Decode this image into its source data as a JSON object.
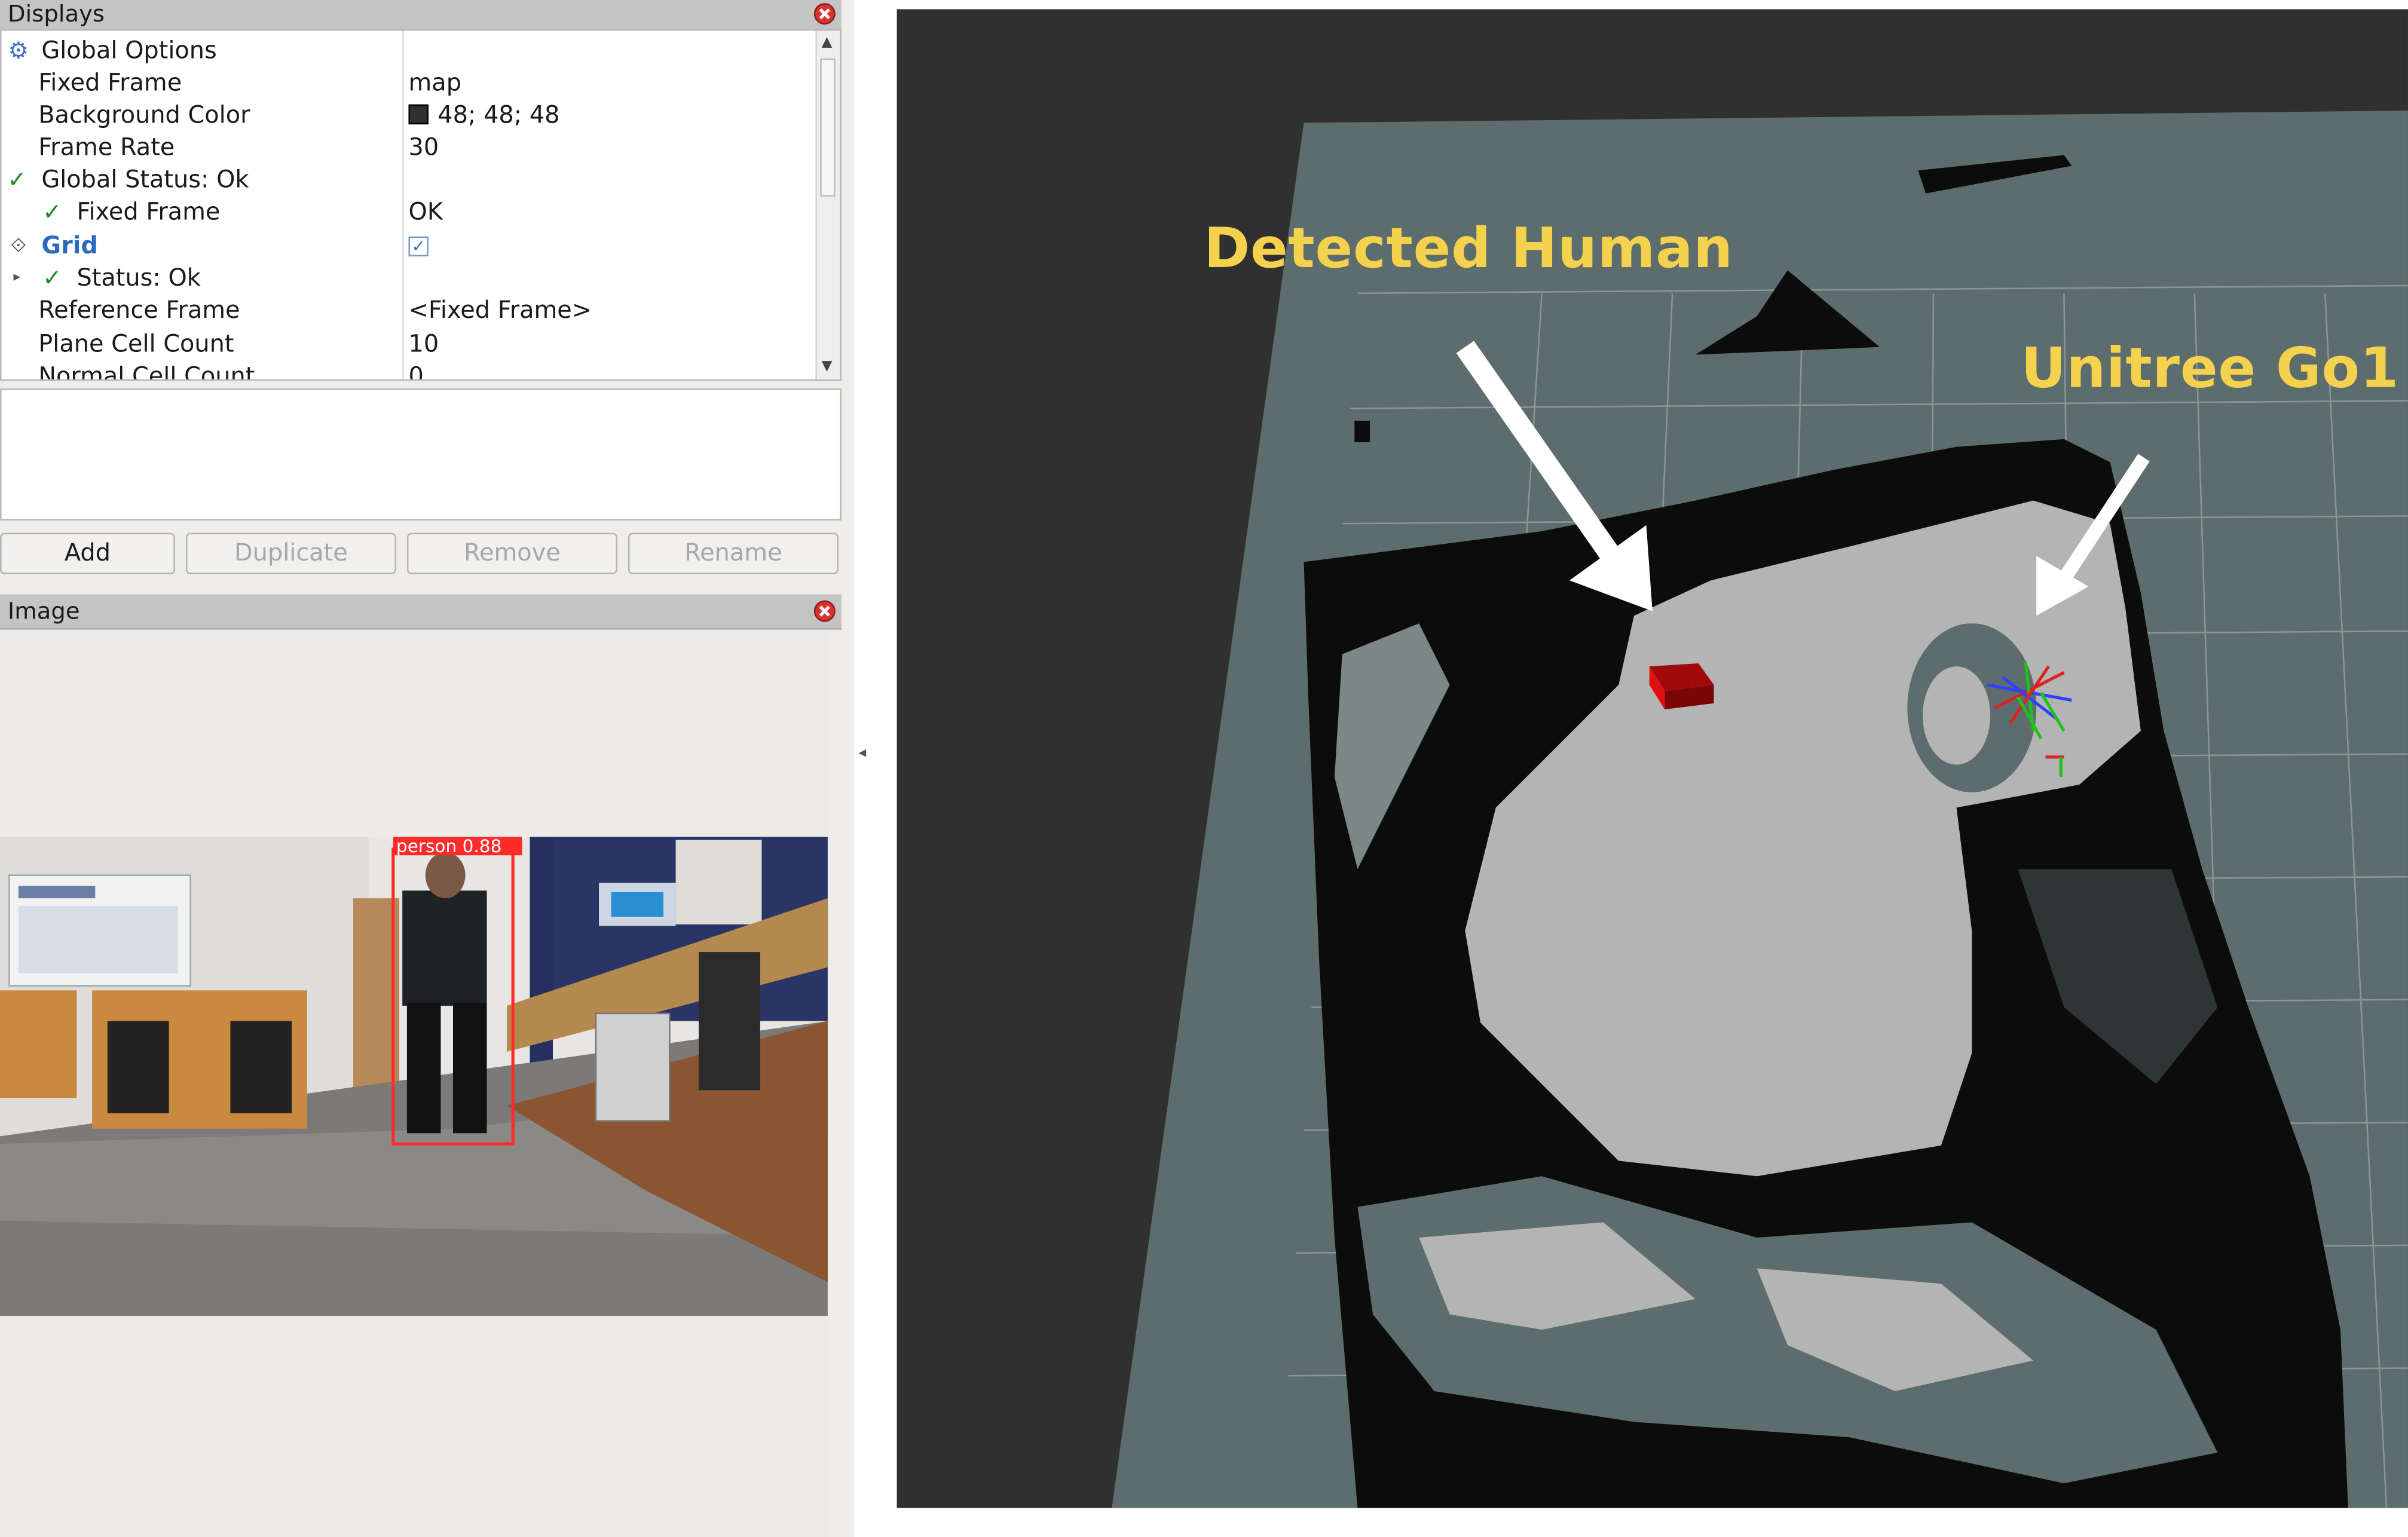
{
  "displays_panel": {
    "title": "Displays",
    "rows": [
      {
        "key": "Global Options",
        "value": ""
      },
      {
        "key": "Fixed Frame",
        "value": "map"
      },
      {
        "key": "Background Color",
        "value": "48; 48; 48"
      },
      {
        "key": "Frame Rate",
        "value": "30"
      },
      {
        "key": "Global Status: Ok",
        "value": ""
      },
      {
        "key": "Fixed Frame",
        "value": "OK"
      },
      {
        "key": "Grid",
        "value": ""
      },
      {
        "key": "Status: Ok",
        "value": ""
      },
      {
        "key": "Reference Frame",
        "value": "<Fixed Frame>"
      },
      {
        "key": "Plane Cell Count",
        "value": "10"
      },
      {
        "key": "Normal Cell Count",
        "value": "0"
      }
    ],
    "grid_enabled": true
  },
  "buttons": {
    "add": "Add",
    "duplicate": "Duplicate",
    "remove": "Remove",
    "rename": "Rename"
  },
  "image_panel": {
    "title": "Image",
    "detection_label": "person  0.88"
  },
  "annotations": {
    "detected_human": "Detected Human",
    "unitree": "Unitree Go1"
  },
  "colors": {
    "background_rgb": "#303030",
    "annotation": "#f4d24e",
    "map_unknown": "#5d6c6c",
    "map_free": "#b4b4b4",
    "map_occupied": "#0c0c0c",
    "human_marker": "#e01010",
    "check": "#1f8a25"
  },
  "icons": {
    "global_options": "gear-icon",
    "status_ok": "checkmark-icon",
    "grid": "grid-icon",
    "close": "close-icon"
  }
}
